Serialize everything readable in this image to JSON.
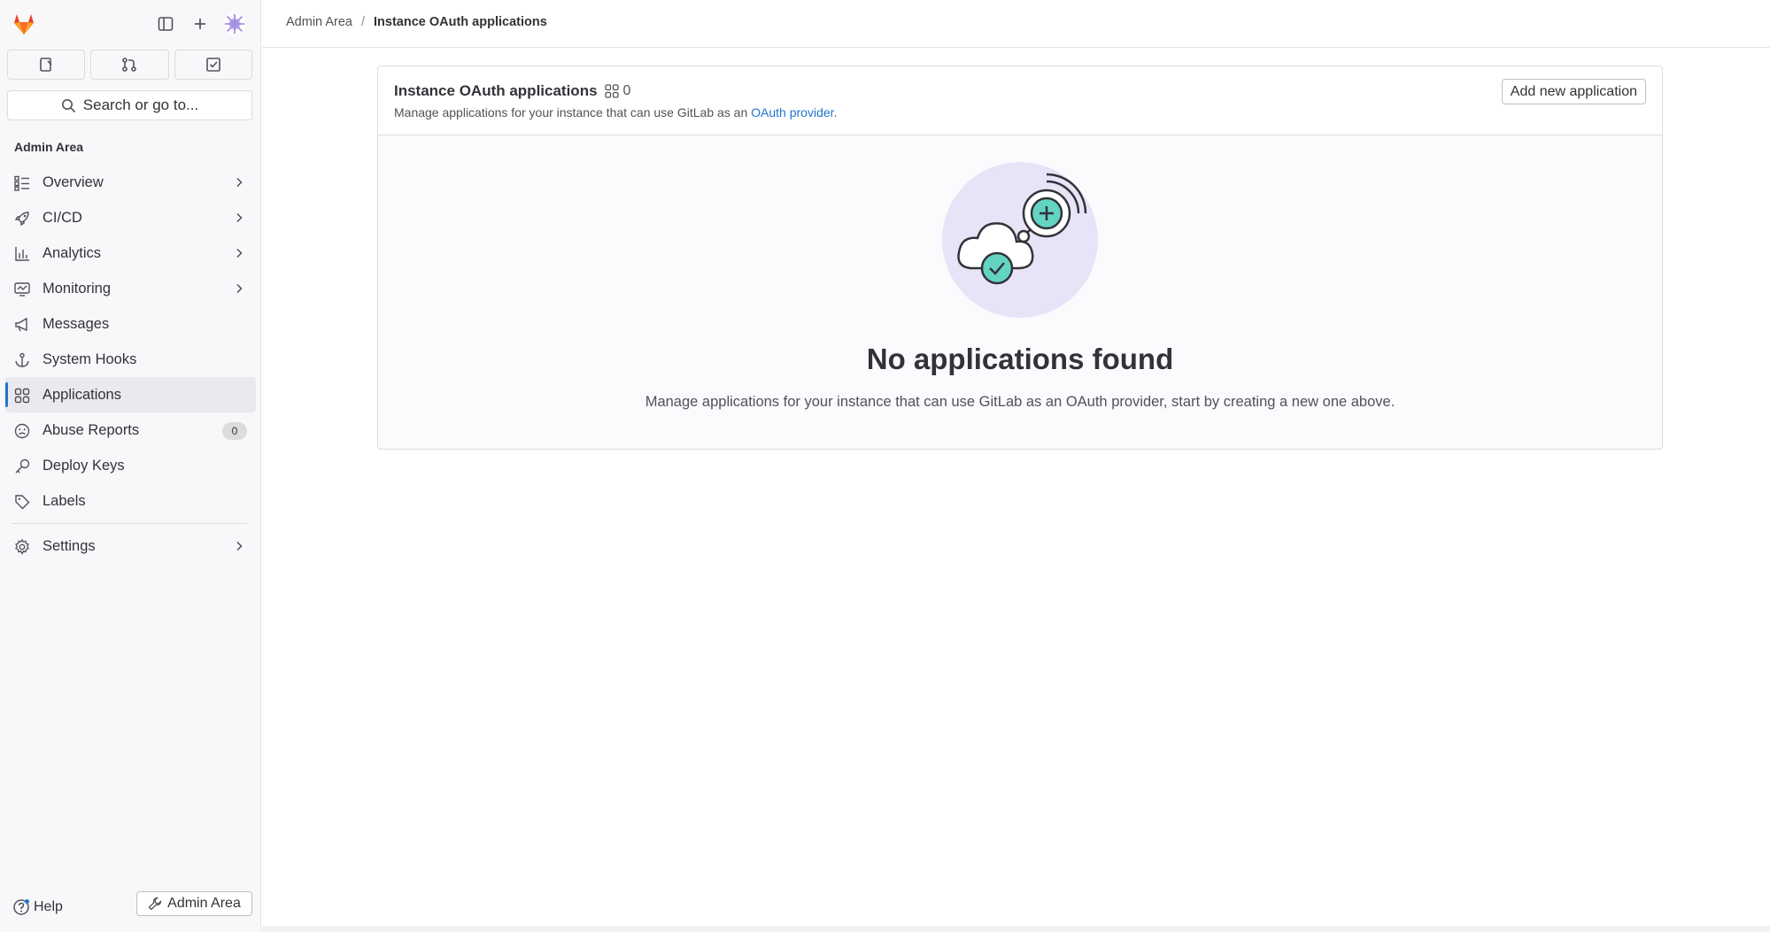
{
  "sidebar": {
    "search_placeholder": "Search or go to...",
    "section_title": "Admin Area",
    "items": [
      {
        "label": "Overview",
        "icon": "overview-icon",
        "chevron": true
      },
      {
        "label": "CI/CD",
        "icon": "rocket-icon",
        "chevron": true
      },
      {
        "label": "Analytics",
        "icon": "chart-icon",
        "chevron": true
      },
      {
        "label": "Monitoring",
        "icon": "monitor-icon",
        "chevron": true
      },
      {
        "label": "Messages",
        "icon": "megaphone-icon",
        "chevron": false
      },
      {
        "label": "System Hooks",
        "icon": "anchor-icon",
        "chevron": false
      },
      {
        "label": "Applications",
        "icon": "applications-icon",
        "chevron": false,
        "active": true
      },
      {
        "label": "Abuse Reports",
        "icon": "abuse-icon",
        "chevron": false,
        "badge": "0"
      },
      {
        "label": "Deploy Keys",
        "icon": "key-icon",
        "chevron": false
      },
      {
        "label": "Labels",
        "icon": "label-icon",
        "chevron": false
      },
      {
        "label": "Settings",
        "icon": "gear-icon",
        "chevron": true
      }
    ],
    "help_label": "Help",
    "admin_area_button": "Admin Area"
  },
  "breadcrumb": {
    "parent": "Admin Area",
    "separator": "/",
    "current": "Instance OAuth applications"
  },
  "card": {
    "title": "Instance OAuth applications",
    "count": "0",
    "description_prefix": "Manage applications for your instance that can use GitLab as an ",
    "description_link": "OAuth provider",
    "description_suffix": ".",
    "add_button": "Add new application"
  },
  "empty_state": {
    "title": "No applications found",
    "description": "Manage applications for your instance that can use GitLab as an OAuth provider, start by creating a new one above."
  },
  "colors": {
    "accent": "#1f75cb",
    "illustration_bg": "#e9e3f7",
    "illustration_teal": "#63d4c2"
  }
}
